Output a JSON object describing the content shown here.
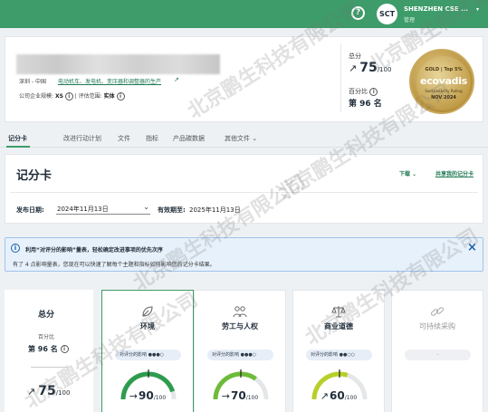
{
  "topbar": {
    "company": "SHENZHEN CSE ...",
    "company_role": "管理",
    "avatar_initials": "SCT",
    "help_glyph": "?"
  },
  "header": {
    "location": "深圳 - 中国",
    "industry": "电动机车、发电机、变压器和调整器的生产",
    "size_label": "公司企业规模:",
    "size_value": "XS",
    "scope_label": "评估范围:",
    "scope_value": "实体",
    "score_label": "总分",
    "score_value": "75",
    "score_max": "/100",
    "percentile_label": "百分比",
    "percentile_value": "第 96 名",
    "medal": {
      "top": "GOLD | Top 5%",
      "brand": "ecovadis",
      "sub": "Sustainability Rating",
      "date": "NOV 2024"
    }
  },
  "tabs": [
    {
      "label": "记分卡",
      "active": true
    },
    {
      "label": "改进行动计划",
      "active": false
    },
    {
      "label": "文件",
      "active": false
    },
    {
      "label": "指标",
      "active": false
    },
    {
      "label": "产品碳数据",
      "active": false
    },
    {
      "label": "其他文件",
      "active": false
    }
  ],
  "scorecard": {
    "title": "记分卡",
    "download": "下载",
    "share": "共享我的记分卡",
    "publish_label": "发布日期:",
    "publish_value": "2024年11月13日",
    "valid_label": "有效期至:",
    "valid_value": "2025年11月13日"
  },
  "banner": {
    "title": "利用“对评分的影响”量表，轻松确定改进事项的优先次序",
    "text": "有了 4 点影响量表，您现在可以快速了解每个主题和指标如何影响您的记分卡结果。"
  },
  "overall": {
    "label": "总分",
    "percentile": "百分比",
    "rank": "第 96 名",
    "score": "75",
    "max": "/100"
  },
  "themes": [
    {
      "name": "环境",
      "icon": "leaf-icon",
      "glyph": "🍃",
      "impact": "对评分的影响 ●●●○",
      "score": "90",
      "max": "/100",
      "value": 90,
      "color": "#2e9c4e"
    },
    {
      "name": "劳工与人权",
      "icon": "people-icon",
      "glyph": "👥",
      "impact": "对评分的影响 ●●●○",
      "score": "70",
      "max": "/100",
      "value": 70,
      "color": "#6dbb3a"
    },
    {
      "name": "商业道德",
      "icon": "scales-icon",
      "glyph": "⚖",
      "impact": "对评分的影响 ●●○○",
      "score": "60",
      "max": "/100",
      "value": 60,
      "color": "#b8cf2a"
    },
    {
      "name": "可持续采购",
      "icon": "chain-icon",
      "glyph": "🔗",
      "impact": "–",
      "score": "",
      "max": "",
      "value": null,
      "color": "#cccccc"
    }
  ],
  "watermark": "北京鹏生科技有限公司",
  "colors": {
    "brand_green": "#3d9c69",
    "link_green": "#1f7a53",
    "info_blue": "#1b5fa8",
    "gold": "#c9a95c"
  }
}
